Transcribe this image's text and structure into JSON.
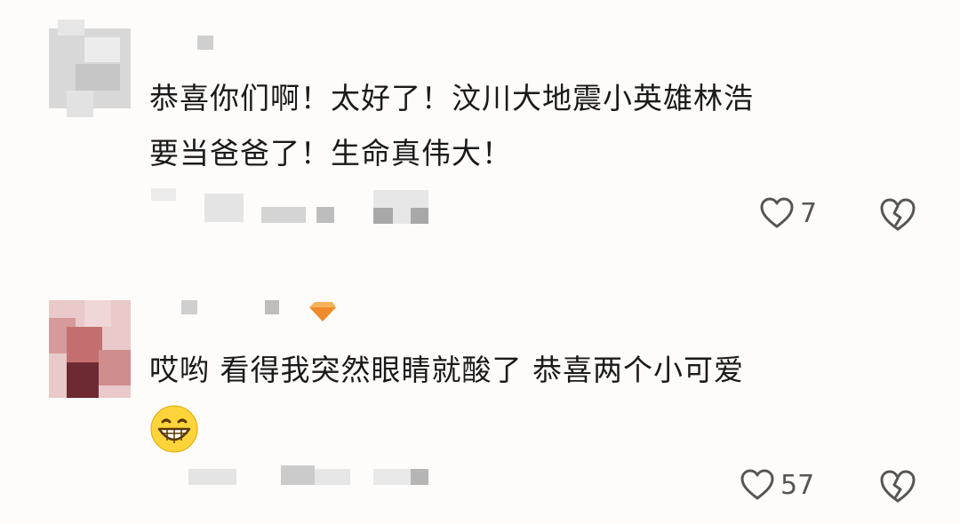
{
  "comments": [
    {
      "text": "恭喜你们啊！太好了！汶川大地震小英雄林浩\n要当爸爸了！生命真伟大！",
      "likes": "7"
    },
    {
      "text": "哎哟 看得我突然眼睛就酸了 恭喜两个小可爱",
      "emoji": "grinning-face",
      "likes": "57"
    }
  ],
  "icons": {
    "like": "heart-outline-icon",
    "dislike": "broken-heart-icon"
  },
  "colors": {
    "background": "#fdfcfa",
    "text": "#1a1a1a",
    "icon": "#555555",
    "mosaic": "#d9d9d9"
  }
}
